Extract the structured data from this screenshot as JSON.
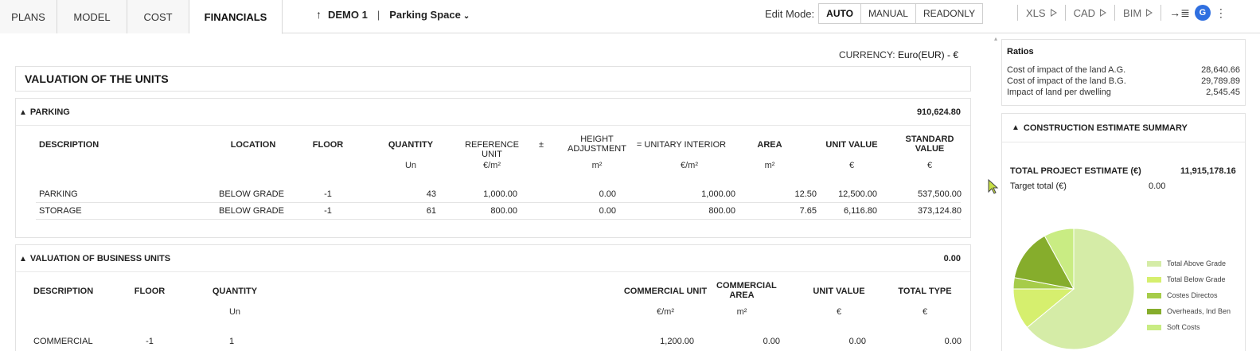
{
  "tabs": [
    {
      "label": "PLANS",
      "active": false
    },
    {
      "label": "MODEL",
      "active": false
    },
    {
      "label": "COST",
      "active": false
    },
    {
      "label": "FINANCIALS",
      "active": true
    }
  ],
  "project": {
    "name": "DEMO 1",
    "space": "Parking Space"
  },
  "edit_mode": {
    "label": "Edit Mode:",
    "options": [
      "AUTO",
      "MANUAL",
      "READONLY"
    ],
    "selected": "AUTO"
  },
  "tools": {
    "xls": "XLS",
    "cad": "CAD",
    "bim": "BIM",
    "avatar": "G"
  },
  "currency": {
    "label": "CURRENCY:",
    "value": "Euro(EUR) - €"
  },
  "valuation_title": "VALUATION OF THE UNITS",
  "parking": {
    "title": "PARKING",
    "total": "910,624.80",
    "headers": {
      "description": "DESCRIPTION",
      "location": "LOCATION",
      "floor": "FLOOR",
      "quantity": "QUANTITY",
      "reference_unit": "REFERENCE UNIT",
      "plus_minus": "±",
      "height_adjustment": "HEIGHT ADJUSTMENT",
      "unitary_interior": "= UNITARY INTERIOR",
      "area": "AREA",
      "unit_value": "UNIT VALUE",
      "standard_value": "STANDARD VALUE"
    },
    "units": {
      "quantity": "Un",
      "reference_unit": "€/m²",
      "height_adjustment": "m²",
      "unitary_interior": "€/m²",
      "area": "m²",
      "unit_value": "€",
      "standard_value": "€"
    },
    "rows": [
      {
        "description": "PARKING",
        "location": "BELOW GRADE",
        "floor": "-1",
        "quantity": "43",
        "reference_unit": "1,000.00",
        "height_adjustment": "0.00",
        "unitary_interior": "1,000.00",
        "area": "12.50",
        "unit_value": "12,500.00",
        "standard_value": "537,500.00"
      },
      {
        "description": "STORAGE",
        "location": "BELOW GRADE",
        "floor": "-1",
        "quantity": "61",
        "reference_unit": "800.00",
        "height_adjustment": "0.00",
        "unitary_interior": "800.00",
        "area": "7.65",
        "unit_value": "6,116.80",
        "standard_value": "373,124.80"
      }
    ]
  },
  "business": {
    "title": "VALUATION OF BUSINESS UNITS",
    "total": "0.00",
    "headers": {
      "description": "DESCRIPTION",
      "floor": "FLOOR",
      "quantity": "QUANTITY",
      "commercial_unit": "COMMERCIAL UNIT",
      "commercial_area": "COMMERCIAL AREA",
      "unit_value": "UNIT VALUE",
      "total_type": "TOTAL TYPE"
    },
    "units": {
      "quantity": "Un",
      "commercial_unit": "€/m²",
      "commercial_area": "m²",
      "unit_value": "€",
      "total_type": "€"
    },
    "rows": [
      {
        "description": "COMMERCIAL",
        "floor": "-1",
        "quantity": "1",
        "commercial_unit": "1,200.00",
        "commercial_area": "0.00",
        "unit_value": "0.00",
        "total_type": "0.00"
      }
    ]
  },
  "ratios": {
    "title": "Ratios",
    "items": [
      {
        "label": "Cost of impact of the land A.G.",
        "value": "28,640.66"
      },
      {
        "label": "Cost of impact of the land B.G.",
        "value": "29,789.89"
      },
      {
        "label": "Impact of land per dwelling",
        "value": "2,545.45"
      }
    ]
  },
  "summary": {
    "title": "CONSTRUCTION ESTIMATE SUMMARY",
    "total_label": "TOTAL PROJECT ESTIMATE (€)",
    "total_value": "11,915,178.16",
    "target_label": "Target total (€)",
    "target_value": "0.00"
  },
  "chart_data": {
    "type": "pie",
    "categories": [
      "Total Above Grade",
      "Total Below Grade",
      "Costes Directos",
      "Overheads, Ind Ben",
      "Soft Costs"
    ],
    "values": [
      64,
      11,
      3,
      14,
      8
    ],
    "colors": [
      "#d5eca7",
      "#d6ef6e",
      "#a6cc4a",
      "#86ad2c",
      "#c9ec83"
    ],
    "legend": "right"
  }
}
